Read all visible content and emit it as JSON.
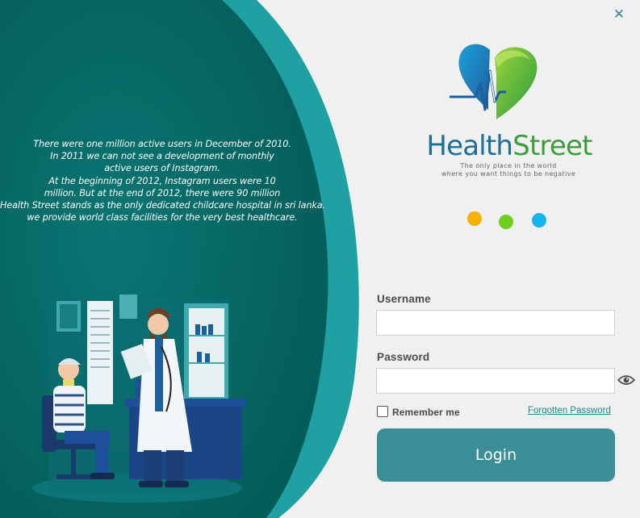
{
  "window": {
    "close_icon": "close-icon",
    "close_glyph": "✕"
  },
  "intro": {
    "lines": [
      "There were one million active users in December of 2010.",
      "In 2011 we can not see a development of monthly",
      "active users of Instagram.",
      "At the beginning of 2012, Instagram users were 10",
      "million. But at the end of 2012, there were 90 million",
      "Health Street stands as the only dedicated childcare hospital in sri lanka.",
      "we provide world class facilities for the very best healthcare."
    ]
  },
  "brand": {
    "name_part1": "Health",
    "name_part2": "Street",
    "tagline_line1": "The only place in the world",
    "tagline_line2": "where you want things to be negative",
    "logo_icon": "heart-heartbeat-logo",
    "dot_colors": [
      "#f8b100",
      "#6fcf1e",
      "#13b5f0"
    ]
  },
  "form": {
    "username_label": "Username",
    "username_value": "",
    "password_label": "Password",
    "password_value": "",
    "show_password_icon": "eye-icon",
    "remember_label": "Remember me",
    "remember_checked": false,
    "forgot_label": "Forgotten Password",
    "login_label": "Login"
  },
  "colors": {
    "panel_teal_dark": "#05625f",
    "panel_teal_light": "#1fa0a3",
    "login_button": "#3a8f96",
    "brand_blue": "#1d6f9b",
    "brand_green": "#3e9d3c"
  }
}
